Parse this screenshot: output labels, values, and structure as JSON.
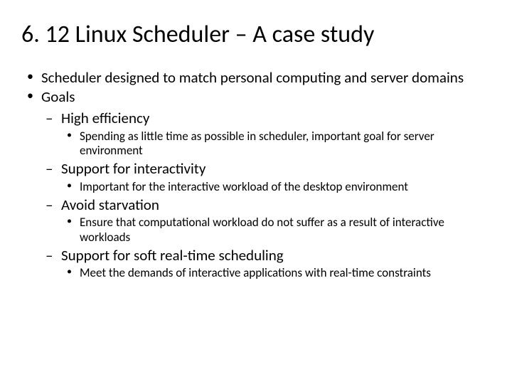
{
  "title": "6. 12 Linux Scheduler – A case study",
  "bullets": {
    "b1": "Scheduler designed to match personal computing and server domains",
    "b2": "Goals",
    "g1": "High efficiency",
    "g1d": "Spending as little time as possible in scheduler, important goal for server environment",
    "g2": "Support for interactivity",
    "g2d": "Important for the interactive workload of the desktop environment",
    "g3": "Avoid starvation",
    "g3d": "Ensure that computational workload do not suffer as a result of interactive workloads",
    "g4": "Support for soft real-time scheduling",
    "g4d": "Meet the demands of interactive applications with real-time constraints"
  }
}
